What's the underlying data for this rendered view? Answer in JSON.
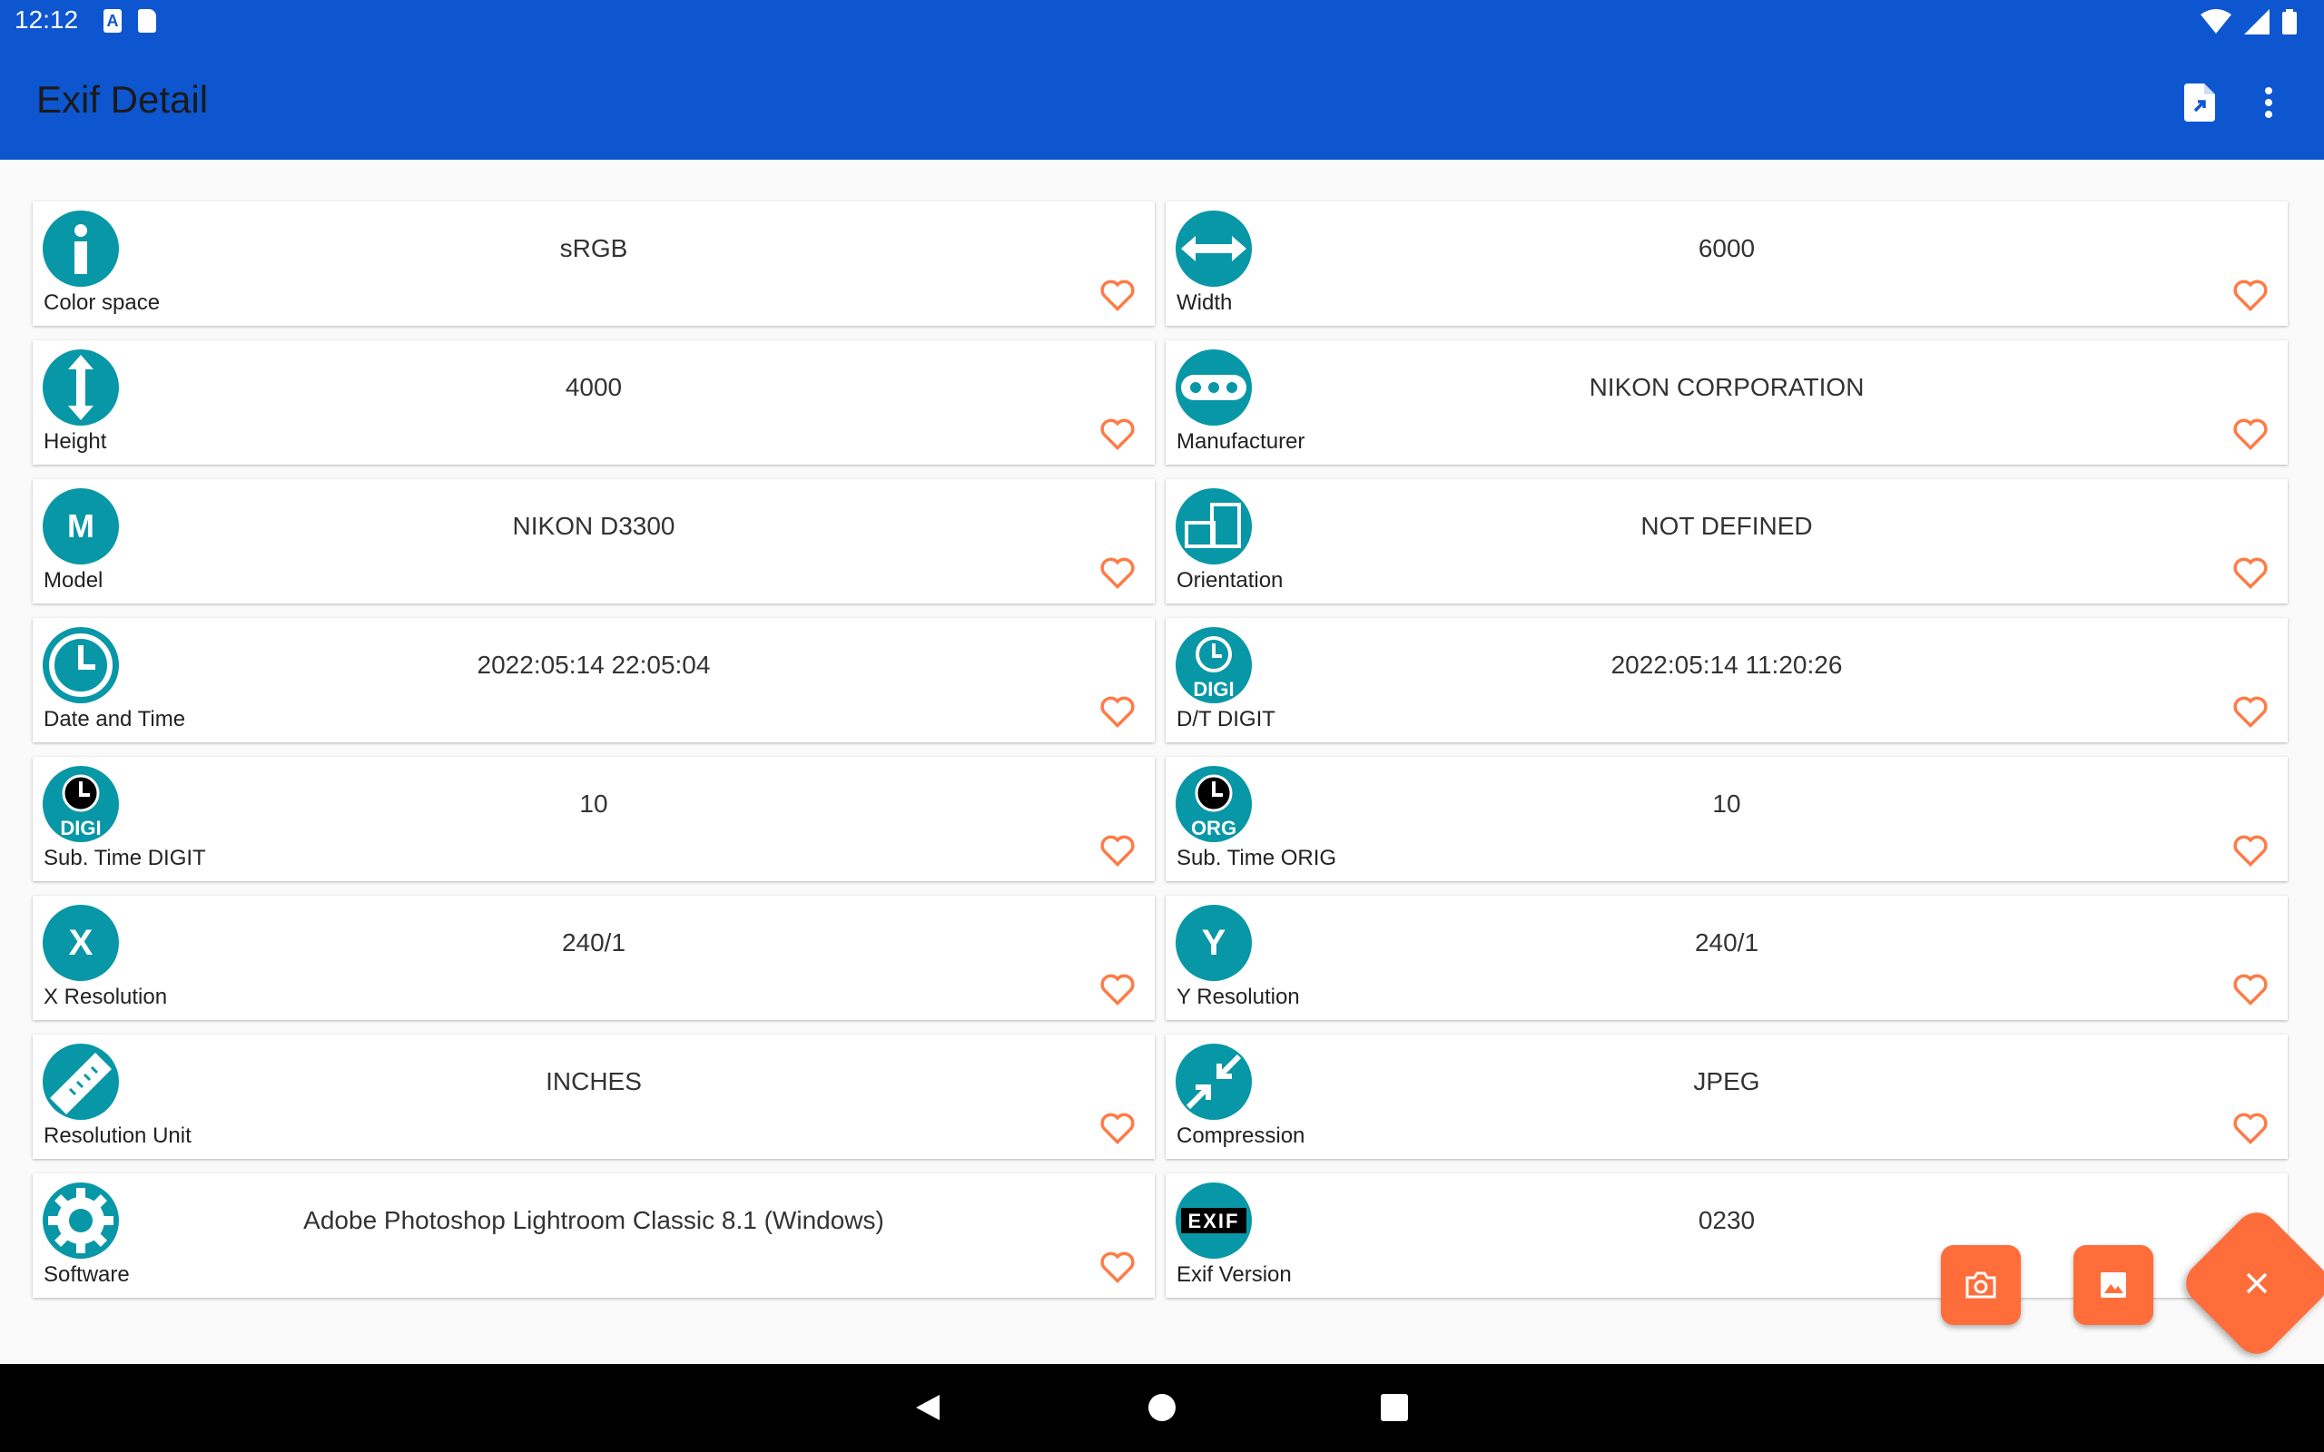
{
  "status_bar": {
    "time": "12:12",
    "left_icons": [
      "a-icon",
      "sd-card-icon"
    ],
    "right_icons": [
      "wifi-icon",
      "signal-icon",
      "battery-icon"
    ]
  },
  "app_bar": {
    "title": "Exif Detail",
    "actions": [
      "export-file-icon",
      "more-vert-icon"
    ]
  },
  "cards": [
    {
      "label": "Color space",
      "value": "sRGB",
      "icon": "info-icon"
    },
    {
      "label": "Width",
      "value": "6000",
      "icon": "width-arrows-icon"
    },
    {
      "label": "Height",
      "value": "4000",
      "icon": "height-arrows-icon"
    },
    {
      "label": "Manufacturer",
      "value": "NIKON CORPORATION",
      "icon": "manufacturer-icon"
    },
    {
      "label": "Model",
      "value": "NIKON D3300",
      "icon": "model-icon",
      "glyph": "M"
    },
    {
      "label": "Orientation",
      "value": "NOT DEFINED",
      "icon": "orientation-icon"
    },
    {
      "label": "Date and Time",
      "value": "2022:05:14 22:05:04",
      "icon": "clock-icon"
    },
    {
      "label": "D/T DIGIT",
      "value": "2022:05:14 11:20:26",
      "icon": "clock-digi-icon",
      "glyph": "DIGI"
    },
    {
      "label": "Sub. Time DIGIT",
      "value": "10",
      "icon": "subtime-digi-icon",
      "glyph": "DIGI"
    },
    {
      "label": "Sub. Time ORIG",
      "value": "10",
      "icon": "subtime-orig-icon",
      "glyph": "ORG"
    },
    {
      "label": "X Resolution",
      "value": "240/1",
      "icon": "x-resolution-icon",
      "glyph": "X"
    },
    {
      "label": "Y Resolution",
      "value": "240/1",
      "icon": "y-resolution-icon",
      "glyph": "Y"
    },
    {
      "label": "Resolution Unit",
      "value": "INCHES",
      "icon": "ruler-icon"
    },
    {
      "label": "Compression",
      "value": "JPEG",
      "icon": "compress-icon"
    },
    {
      "label": "Software",
      "value": "Adobe Photoshop Lightroom Classic 8.1 (Windows)",
      "icon": "gear-icon"
    },
    {
      "label": "Exif Version",
      "value": "0230",
      "icon": "exif-icon",
      "glyph": "EXIF"
    }
  ],
  "fabs": [
    "camera-icon",
    "image-icon",
    "close-icon"
  ],
  "colors": {
    "primary": "#0d56d0",
    "icon_bg": "#0897a6",
    "accent": "#ff6d3a",
    "heart": "#ff7a45"
  }
}
